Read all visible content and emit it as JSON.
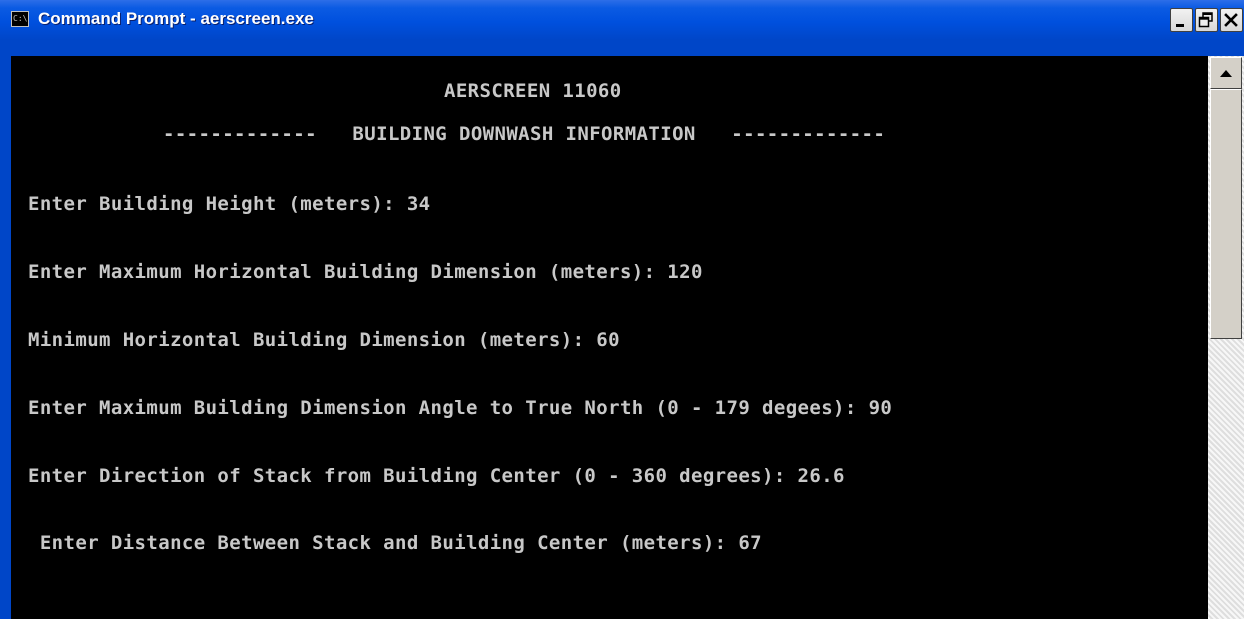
{
  "window": {
    "title": "Command Prompt - aerscreen.exe",
    "icon": "console-icon",
    "icon_text": "C:\\",
    "controls": {
      "minimize": "minimize-icon",
      "maximize": "restore-icon",
      "close": "close-icon"
    }
  },
  "console": {
    "header": "AERSCREEN 11060",
    "section_title": "-------------   BUILDING DOWNWASH INFORMATION   -------------",
    "lines": [
      "Enter Building Height (meters): 34",
      "Enter Maximum Horizontal Building Dimension (meters): 120",
      "Minimum Horizontal Building Dimension (meters): 60",
      "Enter Maximum Building Dimension Angle to True North (0 - 179 degees): 90",
      "Enter Direction of Stack from Building Center (0 - 360 degrees): 26.6",
      " Enter Distance Between Stack and Building Center (meters): 67"
    ]
  },
  "scrollbar": {
    "up_arrow": "scroll-up-icon"
  },
  "colors": {
    "titlebar": "#0050de",
    "console_background": "#000000",
    "console_text": "#c8c8c8"
  }
}
